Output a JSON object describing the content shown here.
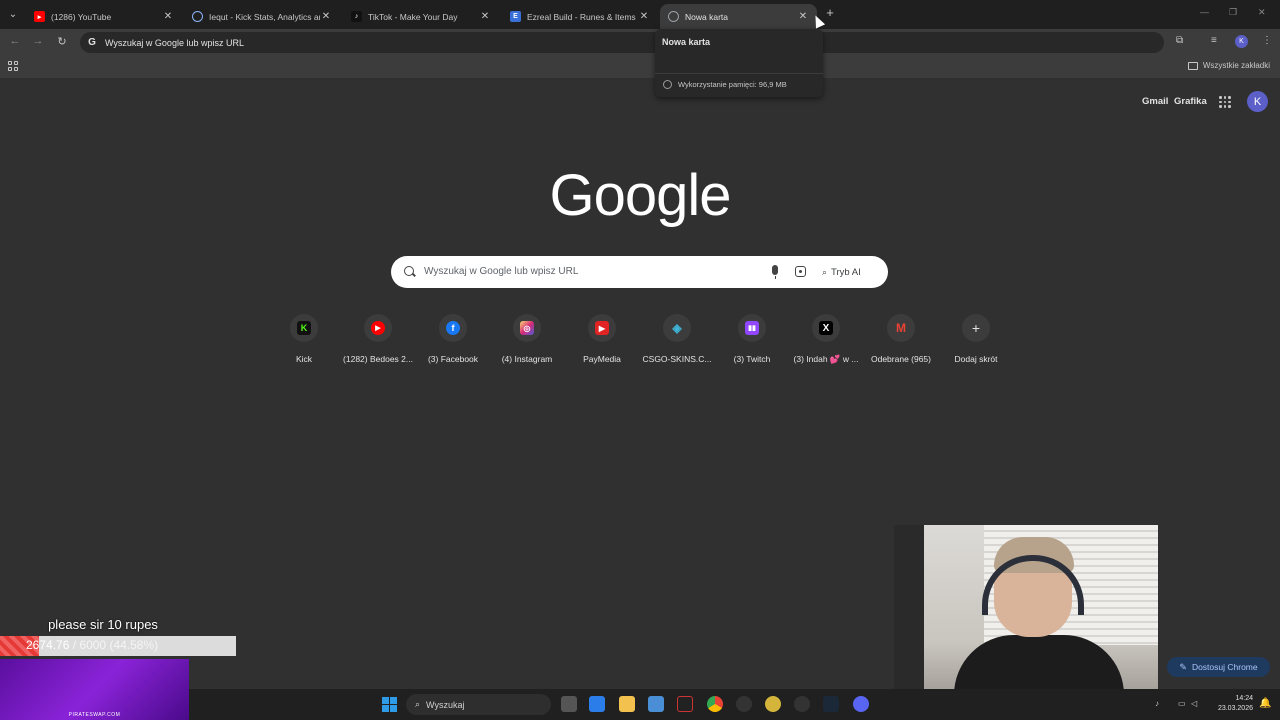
{
  "browser": {
    "tabs": [
      {
        "title": "(1286) YouTube",
        "favicon": "youtube-icon",
        "color": "#ff0000"
      },
      {
        "title": "Iequt - Kick Stats, Analytics and",
        "favicon": "stats-icon",
        "color": "#8ab4f8"
      },
      {
        "title": "TikTok - Make Your Day",
        "favicon": "tiktok-icon",
        "color": "#000000"
      },
      {
        "title": "Ezreal Build - Runes & Items Pa",
        "favicon": "ezreal-icon",
        "color": "#3b6fd8"
      },
      {
        "title": "Nowa karta",
        "favicon": "chrome-icon",
        "color": "#9aa0a6",
        "active": true
      }
    ],
    "hover_card": {
      "title": "Nowa karta",
      "memory": "Wykorzystanie pamięci: 96,9 MB"
    },
    "omnibox": {
      "text": "Wyszukaj w Google lub wpisz URL"
    },
    "profile_initial": "K",
    "bookmarks": {
      "all_bookmarks_label": "Wszystkie zakładki"
    }
  },
  "ntp": {
    "header_links": [
      "Gmail",
      "Grafika"
    ],
    "avatar_initial": "K",
    "logo_text": "Google",
    "search": {
      "placeholder": "Wyszukaj w Google lub wpisz URL",
      "ai_mode_label": "Tryb AI"
    },
    "shortcuts": [
      {
        "label": "Kick",
        "icon": "kick-icon",
        "glyph": "K",
        "color": "#53fc18"
      },
      {
        "label": "(1282) Bedoes 2...",
        "icon": "youtube-icon",
        "glyph": "▶",
        "color": "#ff0000"
      },
      {
        "label": "(3) Facebook",
        "icon": "facebook-icon",
        "glyph": "f",
        "color": "#1877f2"
      },
      {
        "label": "(4) Instagram",
        "icon": "instagram-icon",
        "glyph": "◎",
        "color": "#d62976"
      },
      {
        "label": "PayMedia",
        "icon": "paymedia-icon",
        "glyph": "▶",
        "color": "#e02424"
      },
      {
        "label": "CSGO-SKINS.C...",
        "icon": "csgo-skins-icon",
        "glyph": "◈",
        "color": "#3fb6d8"
      },
      {
        "label": "(3) Twitch",
        "icon": "twitch-icon",
        "glyph": "▮",
        "color": "#9146ff"
      },
      {
        "label": "(3) Indah 💕 w ...",
        "icon": "x-icon",
        "glyph": "X",
        "color": "#000000"
      },
      {
        "label": "Odebrane (965)",
        "icon": "gmail-icon",
        "glyph": "M",
        "color": "#ea4335"
      },
      {
        "label": "Dodaj skrót",
        "icon": "plus-icon",
        "glyph": "+",
        "color": "#3c3c3c"
      }
    ],
    "customize_label": "Dostosuj Chrome"
  },
  "overlay": {
    "donation_message": "please sir 10 rupes",
    "goal": {
      "current": "2674.76",
      "separator": " / ",
      "target": "6000",
      "percent_text": "(44.58%)",
      "fraction": 0.4458
    },
    "promo_text": "PIRATESWAP.COM"
  },
  "taskbar": {
    "search_label": "Wyszukaj",
    "time": "14:24",
    "date": "23.03.2026"
  }
}
